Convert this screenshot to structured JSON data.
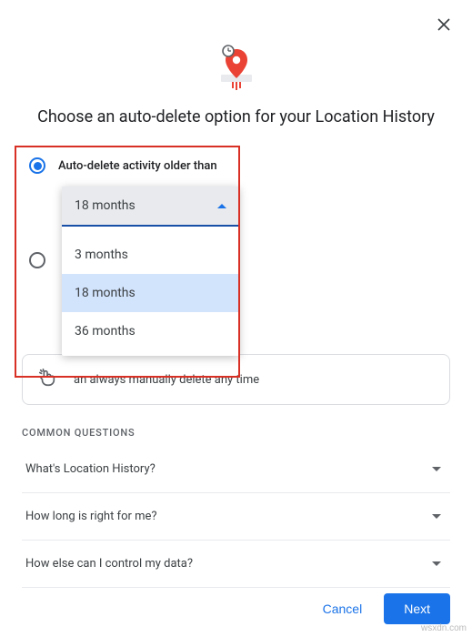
{
  "dialog": {
    "title": "Choose an auto-delete option for your Location History",
    "option1": {
      "label": "Auto-delete activity older than",
      "selected": true,
      "dropdown": {
        "selected_label": "18 months",
        "options": [
          "3 months",
          "18 months",
          "36 months"
        ],
        "highlighted_index": 1
      }
    },
    "option2": {
      "selected": false
    },
    "info_text": "an always manually delete any time",
    "common_questions_header": "COMMON QUESTIONS",
    "faq": [
      "What's Location History?",
      "How long is right for me?",
      "How else can I control my data?"
    ],
    "buttons": {
      "cancel": "Cancel",
      "next": "Next"
    }
  },
  "watermark": "wsxdn.com"
}
